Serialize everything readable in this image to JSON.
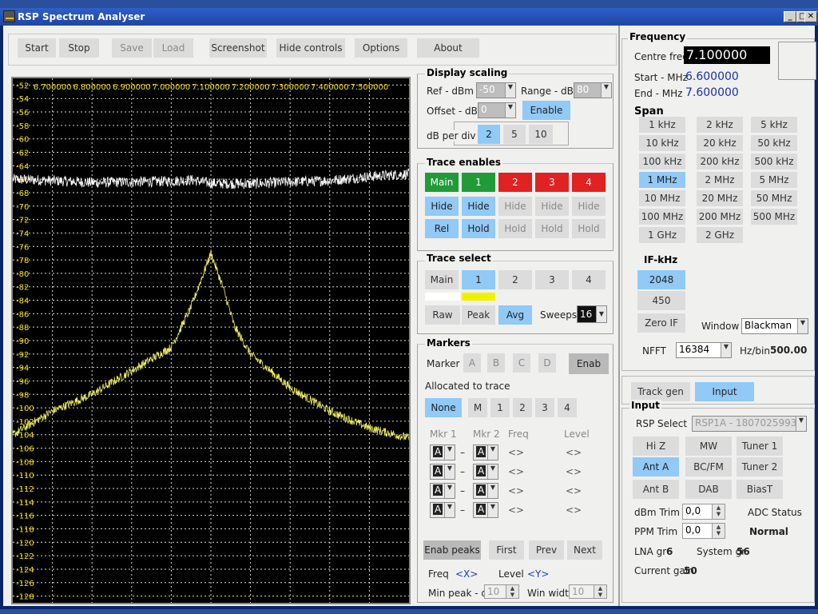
{
  "window": {
    "title": "RSP Spectrum Analyser"
  },
  "toolbar": {
    "start": "Start",
    "stop": "Stop",
    "save": "Save",
    "load": "Load",
    "screenshot": "Screenshot",
    "hide_controls": "Hide controls",
    "options": "Options",
    "about": "About"
  },
  "plot": {
    "freq_labels": [
      "6.700000",
      "6.800000",
      "6.900000",
      "7.000000",
      "7.100000",
      "7.200000",
      "7.300000",
      "7.400000",
      "7.500000"
    ],
    "db_labels": [
      "-52",
      "-54",
      "-56",
      "-58",
      "-60",
      "-62",
      "-64",
      "-66",
      "-68",
      "-70",
      "-72",
      "-74",
      "-76",
      "-78",
      "-80",
      "-82",
      "-84",
      "-86",
      "-88",
      "-90",
      "-92",
      "-94",
      "-96",
      "-98",
      "-100",
      "-102",
      "-104",
      "-106",
      "-108",
      "-110",
      "-112",
      "-114",
      "-116",
      "-118",
      "-120",
      "-122",
      "-124",
      "-126",
      "-128"
    ],
    "colors": {
      "background": "#000000",
      "grid": "#d8d8d8",
      "label": "#f0e010",
      "main_trace": "#ffffff",
      "trace1": "#f0f060"
    }
  },
  "chart_data": {
    "type": "line",
    "xlim": [
      6.6,
      7.6
    ],
    "ylim": [
      -129,
      -51
    ],
    "xlabel": "",
    "ylabel": "",
    "grid": true,
    "series": [
      {
        "x": [
          6.6,
          6.7,
          6.8,
          6.9,
          7.0,
          7.05,
          7.1,
          7.2,
          7.3,
          7.4,
          7.5,
          7.6
        ],
        "values": [
          -66,
          -66.2,
          -66.5,
          -66.4,
          -66.3,
          -66.1,
          -66.6,
          -66.7,
          -66.4,
          -66.2,
          -65.6,
          -65.2
        ]
      },
      {
        "x": [
          6.6,
          6.7,
          6.8,
          6.9,
          7.0,
          7.05,
          7.1,
          7.13,
          7.16,
          7.2,
          7.3,
          7.4,
          7.5,
          7.6
        ],
        "values": [
          -104,
          -100.5,
          -98,
          -94.5,
          -91,
          -85,
          -77,
          -82,
          -88,
          -92,
          -97,
          -100.5,
          -103,
          -104.5
        ]
      }
    ]
  },
  "display_scaling": {
    "title": "Display scaling",
    "ref_label": "Ref - dBm",
    "ref_value": "-50",
    "range_label": "Range - dBm",
    "range_value": "80",
    "offset_label": "Offset - dBm",
    "offset_value": "0",
    "enable": "Enable",
    "dbdiv_label": "dB per div",
    "dbdiv_options": [
      "2",
      "5",
      "10"
    ]
  },
  "trace_enables": {
    "title": "Trace enables",
    "traces": [
      "Main",
      "1",
      "2",
      "3",
      "4"
    ],
    "hide": [
      "Hide",
      "Hide",
      "Hide",
      "Hide",
      "Hide"
    ],
    "hold": [
      "Rel",
      "Hold",
      "Hold",
      "Hold",
      "Hold"
    ]
  },
  "trace_select": {
    "title": "Trace select",
    "traces": [
      "Main",
      "1",
      "2",
      "3",
      "4"
    ],
    "modes": [
      "Raw",
      "Peak",
      "Avg"
    ],
    "sweeps_label": "Sweeps",
    "sweeps_value": "16",
    "swatch_colors": [
      "#ffffff",
      "#f0f000"
    ]
  },
  "markers": {
    "title": "Markers",
    "marker_label": "Marker",
    "marker_buttons": [
      "A",
      "B",
      "C",
      "D"
    ],
    "enab": "Enab",
    "allocated_label": "Allocated to trace",
    "alloc_buttons": [
      "None",
      "M",
      "1",
      "2",
      "3",
      "4"
    ],
    "col_mkr1": "Mkr 1",
    "col_mkr2": "Mkr 2",
    "col_freq": "Freq",
    "col_level": "Level",
    "rows": [
      {
        "m1": "A",
        "sep": "–",
        "m2": "A",
        "freq": "<>",
        "level": "<>"
      },
      {
        "m1": "A",
        "sep": "–",
        "m2": "A",
        "freq": "<>",
        "level": "<>"
      },
      {
        "m1": "A",
        "sep": "–",
        "m2": "A",
        "freq": "<>",
        "level": "<>"
      },
      {
        "m1": "A",
        "sep": "–",
        "m2": "A",
        "freq": "<>",
        "level": "<>"
      }
    ],
    "enab_peaks": "Enab peaks",
    "first": "First",
    "prev": "Prev",
    "next": "Next",
    "freq_label": "Freq",
    "freq_value": "<X>",
    "level_label": "Level",
    "level_value": "<Y>",
    "min_peak_label": "Min peak - dB",
    "min_peak_value": "10",
    "win_width_label": "Win width",
    "win_width_value": "10"
  },
  "frequency": {
    "title": "Frequency",
    "centre_label": "Centre freq",
    "centre_value": "7.100000",
    "start_label": "Start - MHz",
    "start_value": "6.600000",
    "end_label": "End - MHz",
    "end_value": "7.600000",
    "span_label": "Span",
    "span_buttons": [
      "1 kHz",
      "2 kHz",
      "5 kHz",
      "10 kHz",
      "20 kHz",
      "50 kHz",
      "100 kHz",
      "200 kHz",
      "500 kHz",
      "1 MHz",
      "2 MHz",
      "5 MHz",
      "10 MHz",
      "20 MHz",
      "50 MHz",
      "100 MHz",
      "200 MHz",
      "500 MHz",
      "1 GHz",
      "2 GHz"
    ],
    "if_label": "IF-kHz",
    "if_buttons": [
      "2048",
      "450",
      "Zero IF"
    ],
    "window_label": "Window",
    "window_value": "Blackman",
    "nfft_label": "NFFT",
    "nfft_value": "16384",
    "hzbin_label": "Hz/bin",
    "hzbin_value": "500.00"
  },
  "tabs": {
    "track_gen": "Track gen",
    "input": "Input"
  },
  "input": {
    "title": "Input",
    "rsp_select_label": "RSP Select",
    "rsp_select_value": "RSP1A - 1807025993",
    "buttons_row1": [
      "Hi Z",
      "MW",
      "Tuner 1"
    ],
    "buttons_row2": [
      "Ant A",
      "BC/FM",
      "Tuner 2"
    ],
    "buttons_row3": [
      "Ant B",
      "DAB",
      "BiasT"
    ],
    "dbm_trim_label": "dBm Trim",
    "dbm_trim_value": "0,0",
    "ppm_trim_label": "PPM Trim",
    "ppm_trim_value": "0,0",
    "adc_status_label": "ADC Status",
    "adc_status_value": "Normal",
    "lna_label": "LNA gr",
    "lna_value": "6",
    "system_label": "System gr",
    "system_value": "56",
    "current_label": "Current gain",
    "current_value": "50"
  }
}
